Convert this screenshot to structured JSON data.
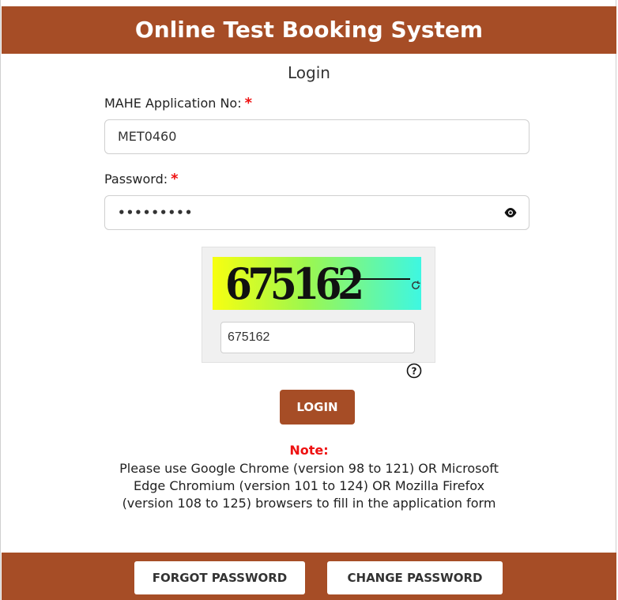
{
  "header": {
    "title": "Online Test Booking System"
  },
  "page": {
    "subtitle": "Login"
  },
  "form": {
    "app_no_label": "MAHE Application No:",
    "app_no_value": "MET0460",
    "password_label": "Password:",
    "password_value": "•••••••••",
    "required_mark": "*"
  },
  "captcha": {
    "image_text": "675162",
    "input_value": "675162"
  },
  "actions": {
    "login_label": "LOGIN"
  },
  "note": {
    "title": "Note:",
    "lines": [
      "Please use Google Chrome (version 98 to 121) OR Microsoft",
      "Edge Chromium (version 101 to 124) OR Mozilla Firefox",
      "(version 108 to 125) browsers to fill in the application form"
    ]
  },
  "footer": {
    "forgot_label": "FORGOT PASSWORD",
    "change_label": "CHANGE PASSWORD"
  },
  "colors": {
    "brand": "#a64d26",
    "required": "#ee1111"
  },
  "icons": {
    "eye": "eye-icon",
    "refresh": "refresh-icon",
    "help": "help-icon"
  }
}
